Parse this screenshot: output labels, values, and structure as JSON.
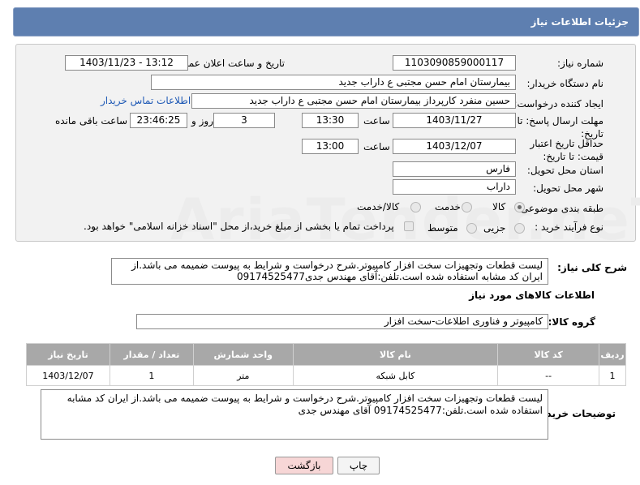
{
  "header": {
    "title": "جزئیات اطلاعات نیاز"
  },
  "form": {
    "need_number_label": "شماره نیاز:",
    "need_number": "1103090859000117",
    "announce_label": "تاریخ و ساعت اعلان عمومی:",
    "announce_value": "1403/11/23 - 13:12",
    "buyer_org_label": "نام دستگاه خریدار:",
    "buyer_org": "بیمارستان امام حسن مجتبی  ع  داراب جدید",
    "creator_label": "ایجاد کننده درخواست:",
    "creator": "حسین  منفرد کارپرداز بیمارستان امام حسن مجتبی  ع  داراب جدید",
    "contact_link": "اطلاعات تماس خریدار",
    "deadline_label": "مهلت ارسال پاسخ: تا تاریخ:",
    "deadline_date": "1403/11/27",
    "time_label": "ساعت",
    "deadline_time": "13:30",
    "days_value": "3",
    "days_label": "روز و",
    "remaining_time": "23:46:25",
    "remaining_label": "ساعت باقی مانده",
    "validity_label": "حداقل تاریخ اعتبار قیمت: تا تاریخ:",
    "validity_date": "1403/12/07",
    "validity_time": "13:00",
    "province_label": "استان محل تحویل:",
    "province": "فارس",
    "city_label": "شهر محل تحویل:",
    "city": "داراب",
    "category_label": "طبقه بندی موضوعی:",
    "category_options": [
      "کالا",
      "خدمت",
      "کالا/خدمت"
    ],
    "category_selected": "کالا",
    "process_label": "نوع فرآیند خرید :",
    "process_options": [
      "جزیی",
      "متوسط"
    ],
    "payment_note": "پرداخت تمام یا بخشی از مبلغ خرید،از محل \"اسناد خزانه اسلامی\" خواهد بود."
  },
  "summary": {
    "label": "شرح کلی نیاز:",
    "text": "لیست قطعات وتجهیزات سخت افزار کامپیوتر.شرح درخواست و شرایط به پیوست ضمیمه می باشد.از ایران کد مشابه استفاده شده است.تلفن:آقای مهندس جدی09174525477"
  },
  "goods": {
    "section_title": "اطلاعات کالاهای مورد نیاز",
    "group_label": "گروه کالا:",
    "group_value": "کامپیوتر و فناوری اطلاعات-سخت افزار",
    "columns": [
      "ردیف",
      "کد کالا",
      "نام کالا",
      "واحد شمارش",
      "تعداد / مقدار",
      "تاریخ نیاز"
    ],
    "rows": [
      [
        "1",
        "--",
        "کابل شبکه",
        "متر",
        "1",
        "1403/12/07"
      ]
    ]
  },
  "buyer_desc": {
    "label": "توضیحات خریدار:",
    "text": "لیست قطعات وتجهیزات سخت افزار کامپیوتر.شرح درخواست و شرایط به پیوست ضمیمه می باشد.از ایران کد مشابه استفاده شده است.تلفن:09174525477 آقای مهندس جدی"
  },
  "buttons": {
    "print": "چاپ",
    "back": "بازگشت"
  },
  "watermark": "AriaTender.neT",
  "colors": {
    "header_bg": "#5e7fb0",
    "link": "#1d58b5",
    "back_btn_bg": "#f7d6d6",
    "table_header": "#a8a8a8"
  }
}
